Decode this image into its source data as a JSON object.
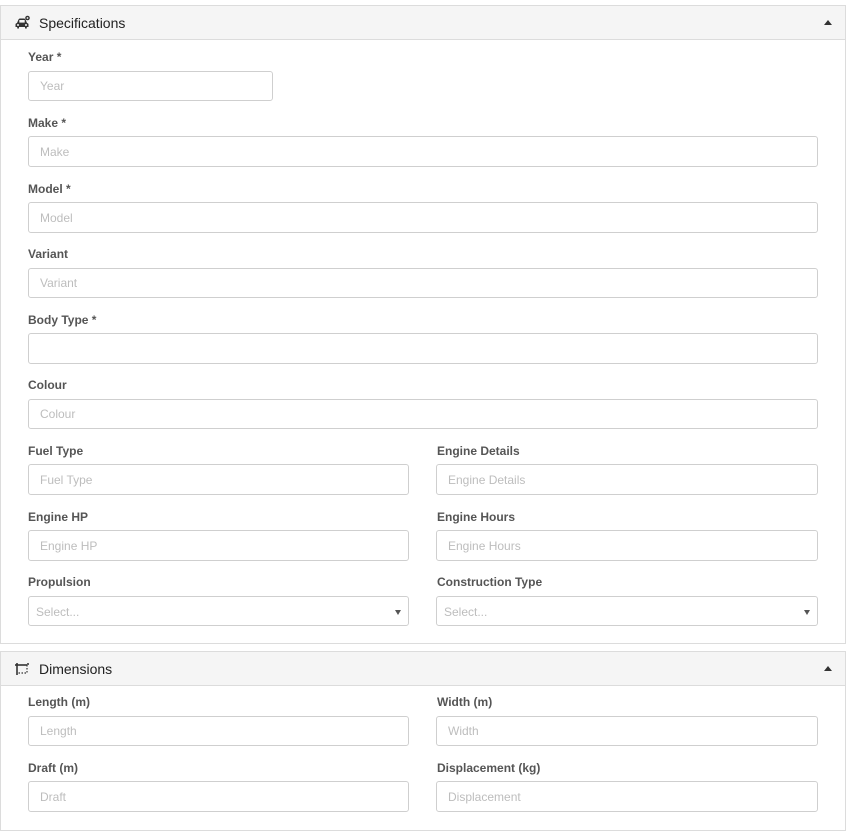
{
  "specifications": {
    "title": "Specifications",
    "icon": "car-icon",
    "fields": {
      "year": {
        "label": "Year *",
        "placeholder": "Year",
        "value": ""
      },
      "make": {
        "label": "Make *",
        "placeholder": "Make",
        "value": ""
      },
      "model": {
        "label": "Model *",
        "placeholder": "Model",
        "value": ""
      },
      "variant": {
        "label": "Variant",
        "placeholder": "Variant",
        "value": ""
      },
      "body_type": {
        "label": "Body Type *",
        "placeholder": "",
        "value": ""
      },
      "colour": {
        "label": "Colour",
        "placeholder": "Colour",
        "value": ""
      },
      "fuel_type": {
        "label": "Fuel Type",
        "placeholder": "Fuel Type",
        "value": ""
      },
      "engine_details": {
        "label": "Engine Details",
        "placeholder": "Engine Details",
        "value": ""
      },
      "engine_hp": {
        "label": "Engine HP",
        "placeholder": "Engine HP",
        "value": ""
      },
      "engine_hours": {
        "label": "Engine Hours",
        "placeholder": "Engine Hours",
        "value": ""
      },
      "propulsion": {
        "label": "Propulsion",
        "selected": "Select..."
      },
      "construction_type": {
        "label": "Construction Type",
        "selected": "Select..."
      }
    }
  },
  "dimensions": {
    "title": "Dimensions",
    "icon": "dimensions-icon",
    "fields": {
      "length": {
        "label": "Length (m)",
        "placeholder": "Length",
        "value": ""
      },
      "width": {
        "label": "Width (m)",
        "placeholder": "Width",
        "value": ""
      },
      "draft": {
        "label": "Draft (m)",
        "placeholder": "Draft",
        "value": ""
      },
      "displacement": {
        "label": "Displacement (kg)",
        "placeholder": "Displacement",
        "value": ""
      }
    }
  }
}
